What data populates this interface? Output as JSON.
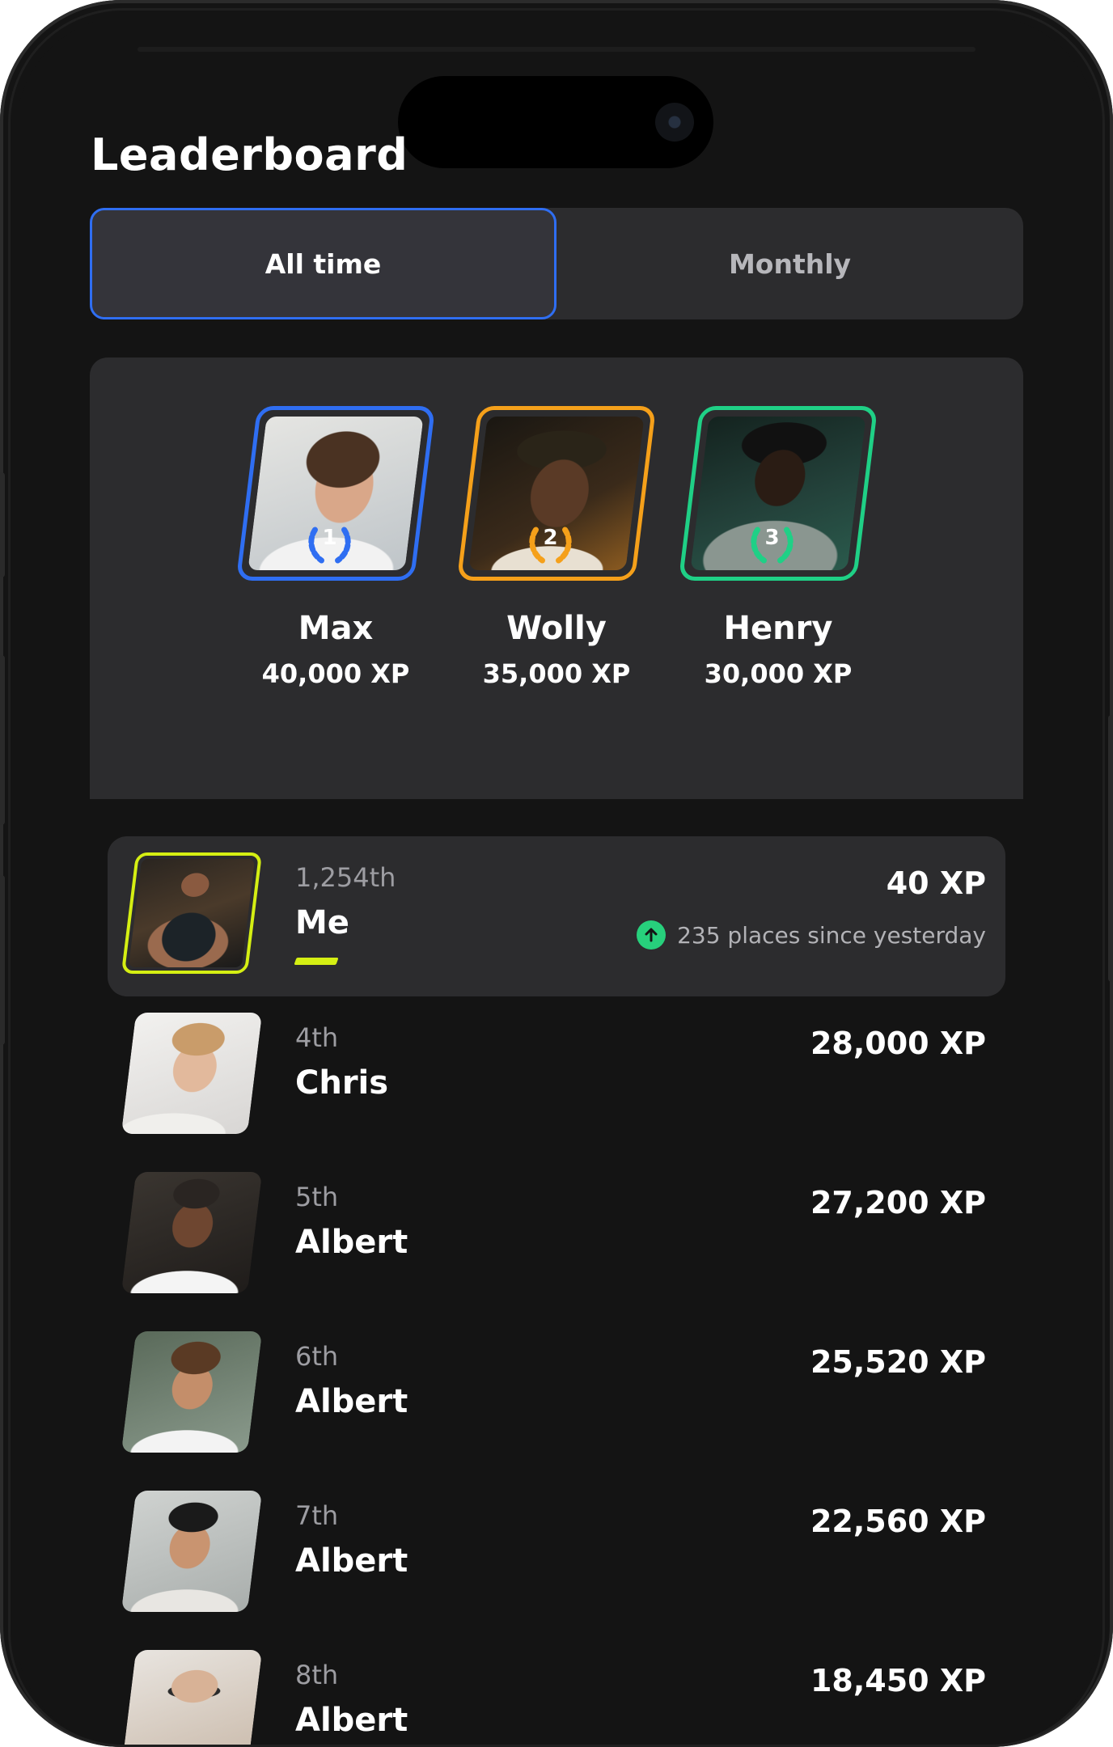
{
  "header": {
    "title": "Leaderboard"
  },
  "tabs": [
    {
      "label": "All time",
      "active": true
    },
    {
      "label": "Monthly",
      "active": false
    }
  ],
  "podium": [
    {
      "place": "1",
      "name": "Max",
      "xp": "40,000 XP",
      "color": "#2f6ef2"
    },
    {
      "place": "2",
      "name": "Wolly",
      "xp": "35,000 XP",
      "color": "#f5a01a"
    },
    {
      "place": "3",
      "name": "Henry",
      "xp": "30,000 XP",
      "color": "#1fd086"
    }
  ],
  "me": {
    "rank": "1,254th",
    "name": "Me",
    "xp": "40 XP",
    "trend": "235 places since yesterday",
    "trend_icon": "arrow-up-icon",
    "accent": "#d5ef13"
  },
  "rows": [
    {
      "rank": "4th",
      "name": "Chris",
      "xp": "28,000 XP"
    },
    {
      "rank": "5th",
      "name": "Albert",
      "xp": "27,200 XP"
    },
    {
      "rank": "6th",
      "name": "Albert",
      "xp": "25,520 XP"
    },
    {
      "rank": "7th",
      "name": "Albert",
      "xp": "22,560 XP"
    },
    {
      "rank": "8th",
      "name": "Albert",
      "xp": "18,450 XP"
    }
  ]
}
